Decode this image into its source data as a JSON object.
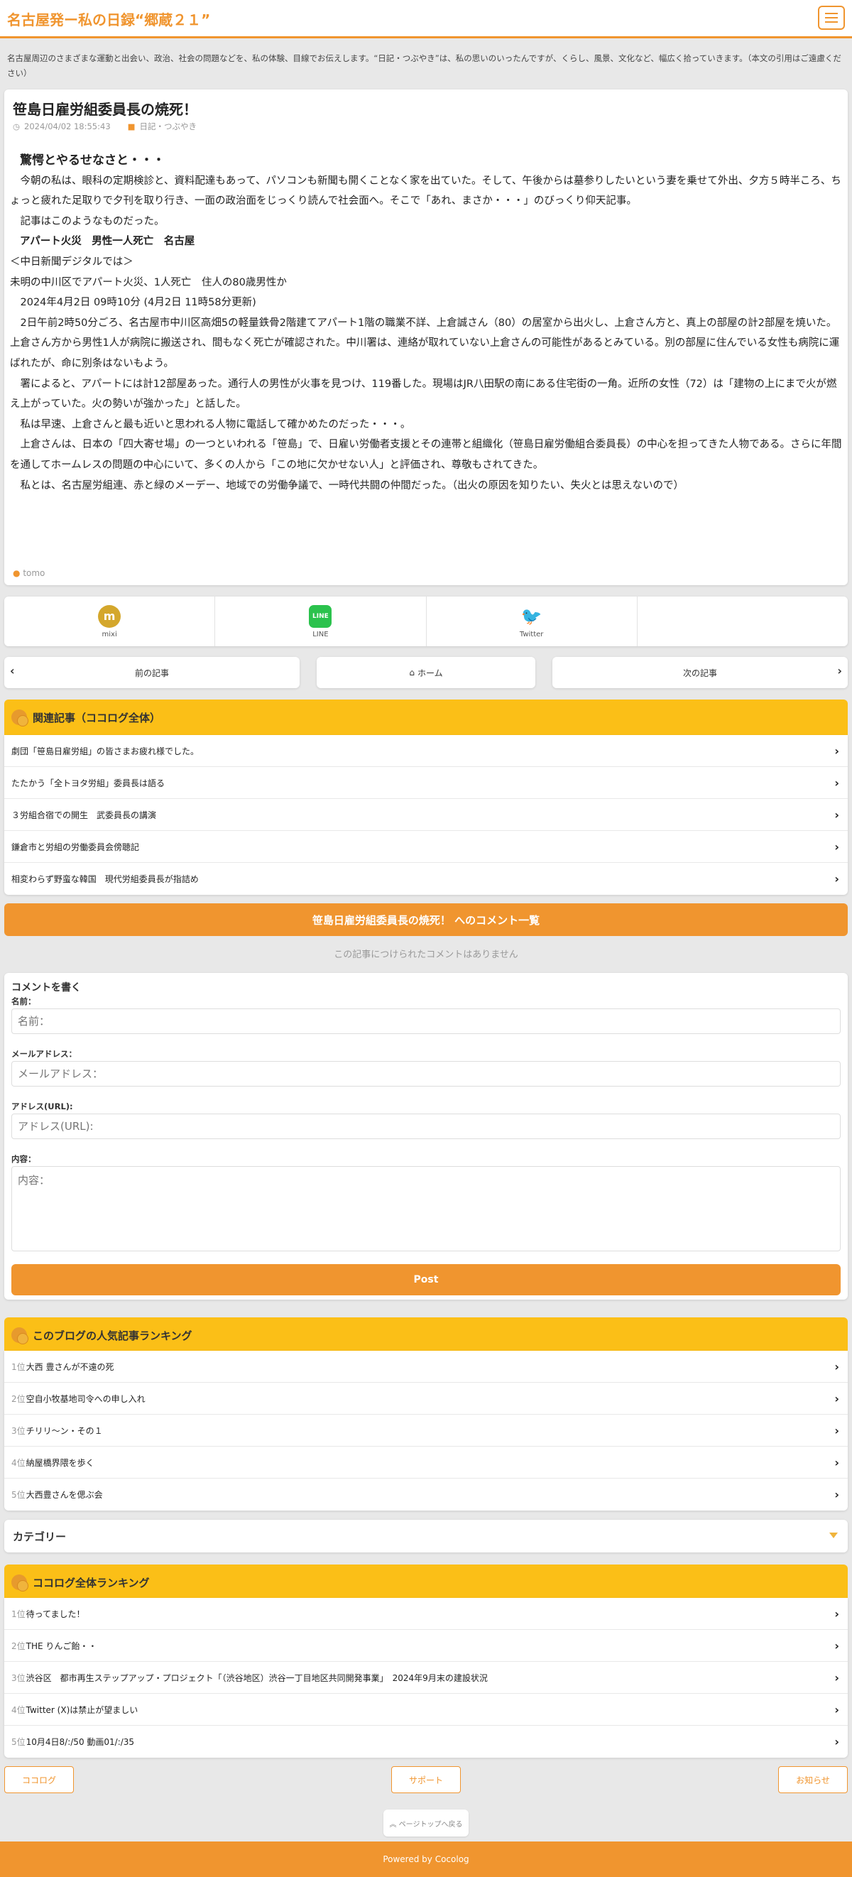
{
  "header": {
    "site_title": "名古屋発ー私の日録“郷蔵２１”"
  },
  "description": "名古屋周辺のさまざまな運動と出会い、政治、社会の問題などを、私の体験、目線でお伝えします。“日記・つぶやき”は、私の思いのいったんですが、くらし、風景、文化など、幅広く拾っていきます。（本文の引用はご遠慮ください）",
  "article": {
    "title": "笹島日雇労組委員長の焼死！",
    "date": "2024/04/02 18:55:43",
    "category": "日記・つぶやき",
    "author": "tomo",
    "heading": "驚愕とやるせなさと・・・",
    "paragraphs": [
      "　今朝の私は、眼科の定期検診と、資料配達もあって、パソコンも新聞も開くことなく家を出ていた。そして、午後からは墓参りしたいという妻を乗せて外出、夕方５時半ころ、ちょっと疲れた足取りで夕刊を取り行き、一面の政治面をじっくり読んで社会面へ。そこで「あれ、まさか・・・」のびっくり仰天記事。",
      "　記事はこのようなものだった。"
    ],
    "news_headline": "アパート火災　男性一人死亡　名古屋",
    "news_source": "＜中日新聞デジタルでは＞",
    "news_lead": "未明の中川区でアパート火災、1人死亡　住人の80歳男性か",
    "news_date": "　2024年4月2日 09時10分 (4月2日 11時58分更新)",
    "news_paragraphs": [
      "　2日午前2時50分ごろ、名古屋市中川区高畑5の軽量鉄骨2階建てアパート1階の職業不詳、上倉誠さん（80）の居室から出火し、上倉さん方と、真上の部屋の計2部屋を焼いた。上倉さん方から男性1人が病院に搬送され、間もなく死亡が確認された。中川署は、連絡が取れていない上倉さんの可能性があるとみている。別の部屋に住んでいる女性も病院に運ばれたが、命に別条はないもよう。",
      "　署によると、アパートには計12部屋あった。通行人の男性が火事を見つけ、119番した。現場はJR八田駅の南にある住宅街の一角。近所の女性（72）は「建物の上にまで火が燃え上がっていた。火の勢いが強かった」と話した。",
      "　私は早速、上倉さんと最も近いと思われる人物に電話して確かめたのだった・・・。",
      "　上倉さんは、日本の「四大寄せ場」の一つといわれる「笹島」で、日雇い労働者支援とその連帯と組織化（笹島日雇労働組合委員長）の中心を担ってきた人物である。さらに年間を通してホームレスの問題の中心にいて、多くの人から「この地に欠かせない人」と評価され、尊敬もされてきた。",
      "　私とは、名古屋労組連、赤と緑のメーデー、地域での労働争議で、一時代共闘の仲間だった。（出火の原因を知りたい、失火とは思えないので）"
    ]
  },
  "share": {
    "mixi": "mixi",
    "line": "LINE",
    "twitter": "Twitter"
  },
  "nav": {
    "prev": "前の記事",
    "home": "ホーム",
    "next": "次の記事"
  },
  "related": {
    "title": "関連記事（ココログ全体）",
    "items": [
      "劇団「笹島日雇労組」の皆さまお疲れ様でした。",
      "たたかう「全トヨタ労組」委員長は語る",
      "３労組合宿での開生　武委員長の講演",
      "鎌倉市と労組の労働委員会傍聴記",
      "相変わらず野蛮な韓国　現代労組委員長が指詰め"
    ]
  },
  "comments": {
    "bar": "笹島日雇労組委員長の焼死！ へのコメント一覧",
    "none": "この記事につけられたコメントはありません",
    "form_title": "コメントを書く",
    "name_label": "名前：",
    "name_placeholder": "名前：",
    "email_label": "メールアドレス：",
    "email_placeholder": "メールアドレス：",
    "url_label": "アドレス(URL):",
    "url_placeholder": "アドレス(URL):",
    "content_label": "内容：",
    "content_placeholder": "内容：",
    "post": "Post"
  },
  "blog_ranking": {
    "title": "このブログの人気記事ランキング",
    "items": [
      {
        "rank": "1位",
        "text": "大西 豊さんが不遠の死"
      },
      {
        "rank": "2位",
        "text": "空自小牧基地司令への申し入れ"
      },
      {
        "rank": "3位",
        "text": "チリリ〜ン・その１"
      },
      {
        "rank": "4位",
        "text": "納屋橋界隈を歩く"
      },
      {
        "rank": "5位",
        "text": "大西豊さんを偲ぶ会"
      }
    ]
  },
  "category": {
    "title": "カテゴリー"
  },
  "cocolog_ranking": {
    "title": "ココログ全体ランキング",
    "items": [
      {
        "rank": "1位",
        "text": "待ってました！"
      },
      {
        "rank": "2位",
        "text": "THE りんご飴・・"
      },
      {
        "rank": "3位",
        "text": "渋谷区　都市再生ステップアップ・プロジェクト「（渋谷地区）渋谷一丁目地区共同開発事業」　2024年9月末の建設状況"
      },
      {
        "rank": "4位",
        "text": "Twitter (X)は禁止が望ましい"
      },
      {
        "rank": "5位",
        "text": "10月4日8/:/50 動画01/:/35"
      }
    ]
  },
  "footer": {
    "cocolog": "ココログ",
    "support": "サポート",
    "notice": "お知らせ",
    "pagetop": "︽ ページトップへ戻る",
    "powered": "Powered by Cocolog"
  },
  "colors": {
    "accent": "#f0952f",
    "section": "#fbbf17"
  }
}
